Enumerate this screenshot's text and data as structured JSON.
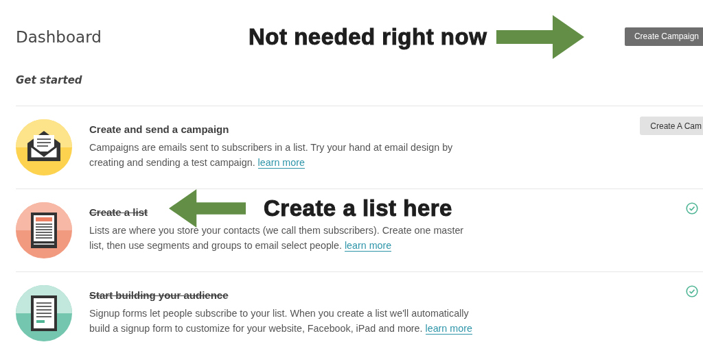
{
  "page": {
    "title": "Dashboard",
    "header_button": "Create Campaign"
  },
  "section": {
    "title": "Get started"
  },
  "steps": [
    {
      "kind": "campaign",
      "title": "Create and send a campaign",
      "description": "Campaigns are emails sent to subscribers in a list. Try your hand at email design by creating and sending a test campaign.",
      "link": "learn more",
      "completed": false,
      "action": "Create A Cam"
    },
    {
      "kind": "list",
      "title": "Create a list",
      "description": "Lists are where you store your contacts (we call them subscribers). Create one master list, then use segments and groups to email select people.",
      "link": "learn more",
      "completed": true
    },
    {
      "kind": "form",
      "title": "Start building your audience",
      "description": "Signup forms let people subscribe to your list. When you create a list we'll automatically build a signup form to customize for your website, Facebook, iPad and more.",
      "link": "learn more",
      "completed": true
    }
  ],
  "annotations": [
    {
      "text": "Not needed right now",
      "kind": "arrow-right"
    },
    {
      "text": "Create a list here",
      "kind": "arrow-left"
    }
  ]
}
